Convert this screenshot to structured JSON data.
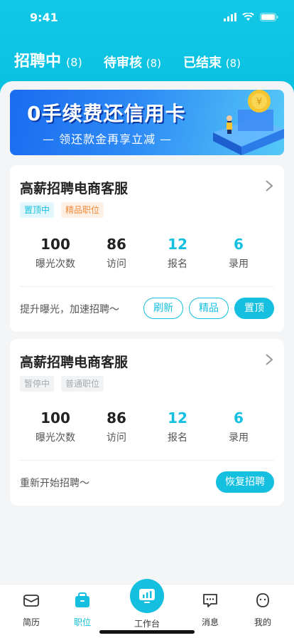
{
  "status": {
    "time": "9:41"
  },
  "tabs": [
    {
      "label": "招聘中",
      "count": "(8)"
    },
    {
      "label": "待审核",
      "count": "(8)"
    },
    {
      "label": "已结束",
      "count": "(8)"
    }
  ],
  "banner": {
    "title": "0手续费还信用卡",
    "subtitle": "— 领还款金再享立减 —"
  },
  "jobs": [
    {
      "title": "高薪招聘电商客服",
      "tags": [
        "置顶中",
        "精品职位"
      ],
      "stats": [
        {
          "value": "100",
          "label": "曝光次数"
        },
        {
          "value": "86",
          "label": "访问"
        },
        {
          "value": "12",
          "label": "报名"
        },
        {
          "value": "6",
          "label": "录用"
        }
      ],
      "footer": "提升曝光，加速招聘～",
      "buttons": [
        "刷新",
        "精品",
        "置顶"
      ]
    },
    {
      "title": "高薪招聘电商客服",
      "tags": [
        "暂停中",
        "普通职位"
      ],
      "stats": [
        {
          "value": "100",
          "label": "曝光次数"
        },
        {
          "value": "86",
          "label": "访问"
        },
        {
          "value": "12",
          "label": "报名"
        },
        {
          "value": "6",
          "label": "录用"
        }
      ],
      "footer": "重新开始招聘～",
      "buttons": [
        "恢复招聘"
      ]
    }
  ],
  "tabbar": [
    {
      "label": "简历",
      "icon": "resume-icon"
    },
    {
      "label": "职位",
      "icon": "briefcase-icon"
    },
    {
      "label": "工作台",
      "icon": "dashboard-icon"
    },
    {
      "label": "消息",
      "icon": "message-icon"
    },
    {
      "label": "我的",
      "icon": "profile-icon"
    }
  ],
  "colors": {
    "accent": "#14bfe0",
    "orange": "#f28a38"
  }
}
